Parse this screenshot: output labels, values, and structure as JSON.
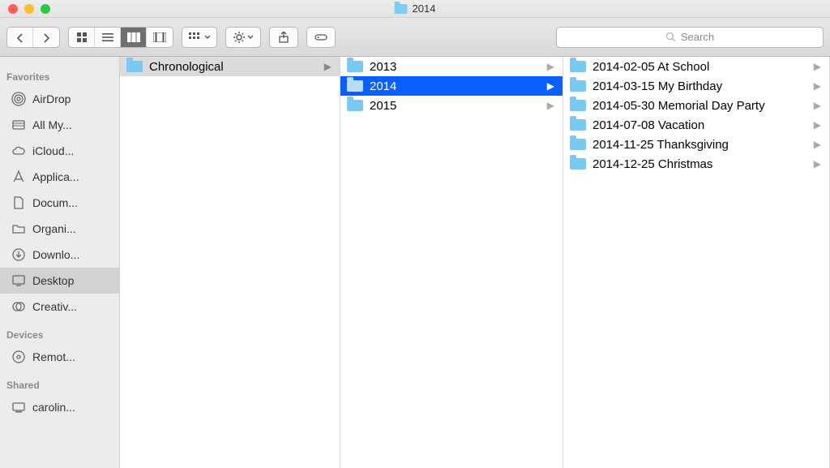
{
  "window": {
    "title": "2014"
  },
  "search": {
    "placeholder": "Search"
  },
  "sidebar": {
    "sections": [
      {
        "title": "Favorites",
        "items": [
          {
            "label": "AirDrop",
            "icon": "airdrop"
          },
          {
            "label": "All My...",
            "icon": "allmy"
          },
          {
            "label": "iCloud...",
            "icon": "icloud"
          },
          {
            "label": "Applica...",
            "icon": "apps"
          },
          {
            "label": "Docum...",
            "icon": "docs"
          },
          {
            "label": "Organi...",
            "icon": "folder"
          },
          {
            "label": "Downlo...",
            "icon": "downloads"
          },
          {
            "label": "Desktop",
            "icon": "desktop",
            "selected": true
          },
          {
            "label": "Creativ...",
            "icon": "cc"
          }
        ]
      },
      {
        "title": "Devices",
        "items": [
          {
            "label": "Remot...",
            "icon": "disc"
          }
        ]
      },
      {
        "title": "Shared",
        "items": [
          {
            "label": "carolin...",
            "icon": "computer"
          }
        ]
      }
    ]
  },
  "columns": [
    {
      "items": [
        {
          "label": "Chronological",
          "state": "inactive"
        }
      ]
    },
    {
      "items": [
        {
          "label": "2013"
        },
        {
          "label": "2014",
          "state": "selected"
        },
        {
          "label": "2015"
        }
      ]
    },
    {
      "items": [
        {
          "label": "2014-02-05 At School"
        },
        {
          "label": "2014-03-15 My Birthday"
        },
        {
          "label": "2014-05-30 Memorial Day Party"
        },
        {
          "label": "2014-07-08 Vacation"
        },
        {
          "label": "2014-11-25 Thanksgiving"
        },
        {
          "label": "2014-12-25 Christmas"
        }
      ]
    }
  ]
}
